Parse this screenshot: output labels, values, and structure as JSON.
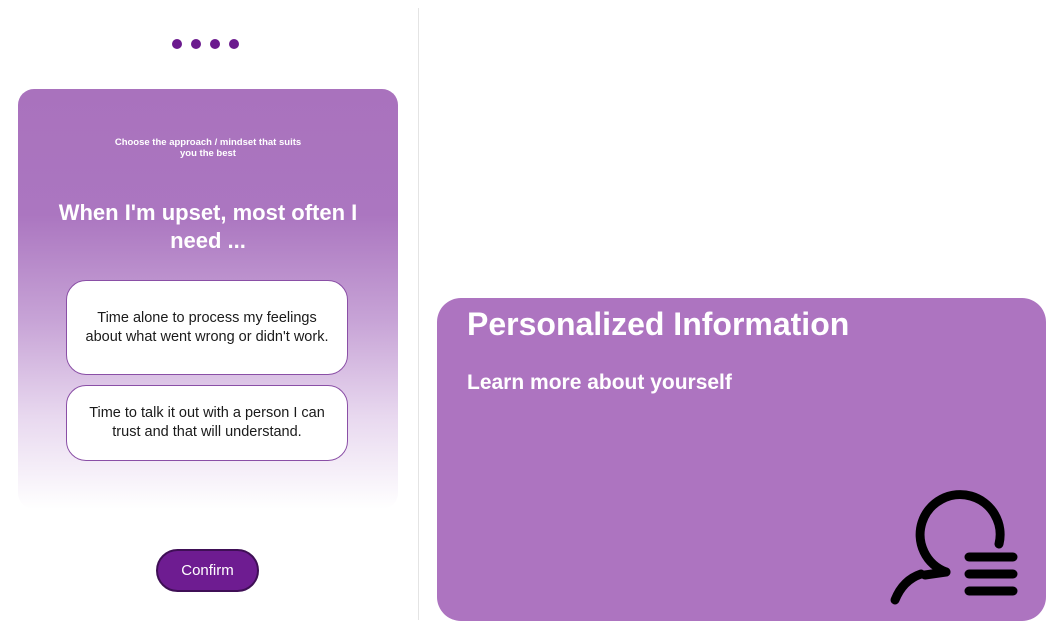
{
  "progress": {
    "total_steps": 4
  },
  "quiz": {
    "instruction": "Choose the approach / mindset that suits you the best",
    "question": "When I'm upset, most often I need ...",
    "options": [
      {
        "label": "Time alone to process my feelings about what went wrong or didn't work."
      },
      {
        "label": "Time to talk it out with a person I can trust and that will understand."
      }
    ],
    "confirm_label": "Confirm"
  },
  "info_card": {
    "title": "Personalized Information",
    "subtitle": "Learn more about yourself",
    "icon": "person-info-icon"
  },
  "colors": {
    "accent": "#6e1c91",
    "card_purple": "#ad74c0",
    "dot_purple": "#6b1a8e"
  }
}
